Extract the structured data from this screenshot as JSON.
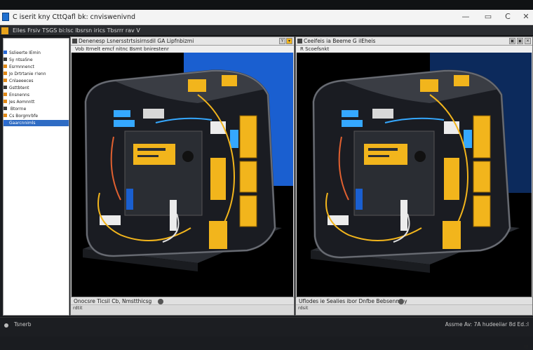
{
  "window": {
    "title": "C  iserit kny CttQafl bk: cnviswenivnd",
    "minimize_glyph": "—",
    "restore_glyph": "▭",
    "refresh_glyph": "C",
    "close_glyph": "✕"
  },
  "menubar": {
    "text": "Elles  Frsiv TSGS  bi:lsc lbsrsn  irics  Tbsrrr rav  V"
  },
  "tree": {
    "items": [
      {
        "label": "Sslieerte  IEmin",
        "icon_color": "#2a6bd8",
        "selected": false
      },
      {
        "label": "Sy ntsaSne",
        "icon_color": "#3a3a3a",
        "selected": false
      },
      {
        "label": "Esrmnnenct",
        "icon_color": "#e28a17",
        "selected": false
      },
      {
        "label": "Jo  Drtrtanie r!enn",
        "icon_color": "#e28a17",
        "selected": false
      },
      {
        "label": "Cnlaeeeces",
        "icon_color": "#e28a17",
        "selected": false
      },
      {
        "label": "Gsttbtent",
        "icon_color": "#3a3a3a",
        "selected": false
      },
      {
        "label": "Ensnenns",
        "icon_color": "#e28a17",
        "selected": false
      },
      {
        "label": "Jes  Aomnntt",
        "icon_color": "#e28a17",
        "selected": false
      },
      {
        "label": "  Btorrne",
        "icon_color": "#3a3a3a",
        "selected": false
      },
      {
        "label": "Cs  Borgmrbfe",
        "icon_color": "#e28a17",
        "selected": false
      },
      {
        "label": "Gaarcnnimls",
        "icon_color": "#2a6bd8",
        "selected": true
      }
    ]
  },
  "left_panel": {
    "header": "Denenesp Lsnersstrtsisirnsdil GA Lipfnbizmi",
    "subheader": "Vob Itrnelt  emcf  nitnc Bsmt bnirestenr",
    "status": "Onocsre  Ticsil  Cb,  Nmstthicsg",
    "foot": "rdtit",
    "buttons": [
      "Y",
      "▾"
    ]
  },
  "right_panel": {
    "header": "Ceeifeis ia Beeme  G   ilEheis",
    "subheader": "R  Scoefsnkt",
    "status": "Uflodes ie  Sealies ibor  Dnfbe Bebsenmey",
    "foot": "rdsit",
    "foot_mark": "!!",
    "buttons": [
      "▣",
      "▣",
      "✕"
    ]
  },
  "statusbar": {
    "left": "Tsnerb",
    "right": "Assme  Av:  7A  hudeeiiar 8d  Ed.:l"
  },
  "colors": {
    "case_yellow": "#f2b51c",
    "case_dark": "#2a2d33",
    "accent_blue": "#1a5fd0",
    "cable_blue": "#35a8ff"
  }
}
